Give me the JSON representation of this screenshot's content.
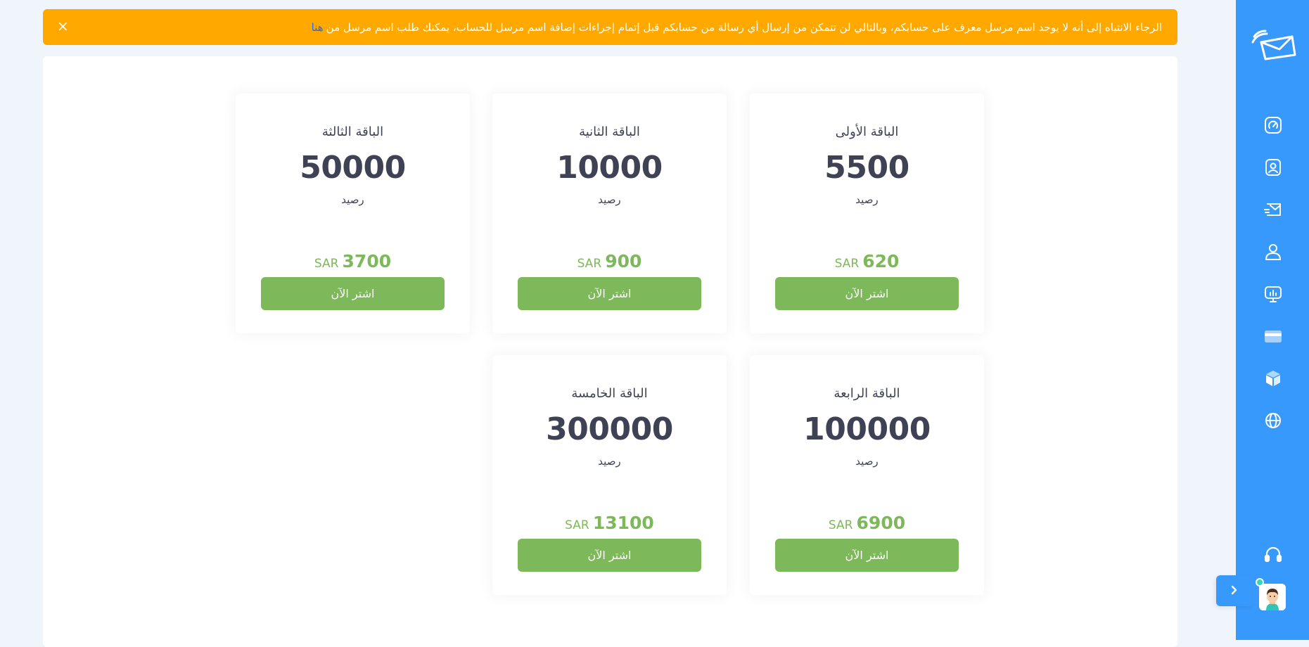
{
  "alert": {
    "message": "الرجاء الانتباه إلى أنه لا يوجد اسم مرسل معرف على حسابكم، وبالتالي لن تتمكن من إرسال أي رسالة من حسابكم قبل إتمام إجراءات إضافة اسم مرسل للحساب، يمكنك طلب اسم مرسل من",
    "link_text": "هنا",
    "close_symbol": "×",
    "color": "#ffa800"
  },
  "packages": [
    {
      "title": "الباقة الأولى",
      "quantity": "5500",
      "unit": "رصيد",
      "price": "620",
      "currency": "SAR",
      "button": "اشتر الآن"
    },
    {
      "title": "الباقة الثانية",
      "quantity": "10000",
      "unit": "رصيد",
      "price": "900",
      "currency": "SAR",
      "button": "اشتر الآن"
    },
    {
      "title": "الباقة الثالثة",
      "quantity": "50000",
      "unit": "رصيد",
      "price": "3700",
      "currency": "SAR",
      "button": "اشتر الآن"
    },
    {
      "title": "الباقة الرابعة",
      "quantity": "100000",
      "unit": "رصيد",
      "price": "6900",
      "currency": "SAR",
      "button": "اشتر الآن"
    },
    {
      "title": "الباقة الخامسة",
      "quantity": "300000",
      "unit": "رصيد",
      "price": "13100",
      "currency": "SAR",
      "button": "اشتر الآن"
    }
  ],
  "sidebar": {
    "icons": [
      "logo-icon",
      "dashboard-icon",
      "contacts-icon",
      "messages-icon",
      "profile-icon",
      "reports-icon",
      "billing-icon",
      "packages-icon",
      "globe-icon",
      "support-icon",
      "expand-icon"
    ],
    "color": "#3899fc"
  },
  "colors": {
    "accent_green": "#7db85a",
    "text_dark": "#3f4254",
    "link_blue": "#1e6bff"
  }
}
